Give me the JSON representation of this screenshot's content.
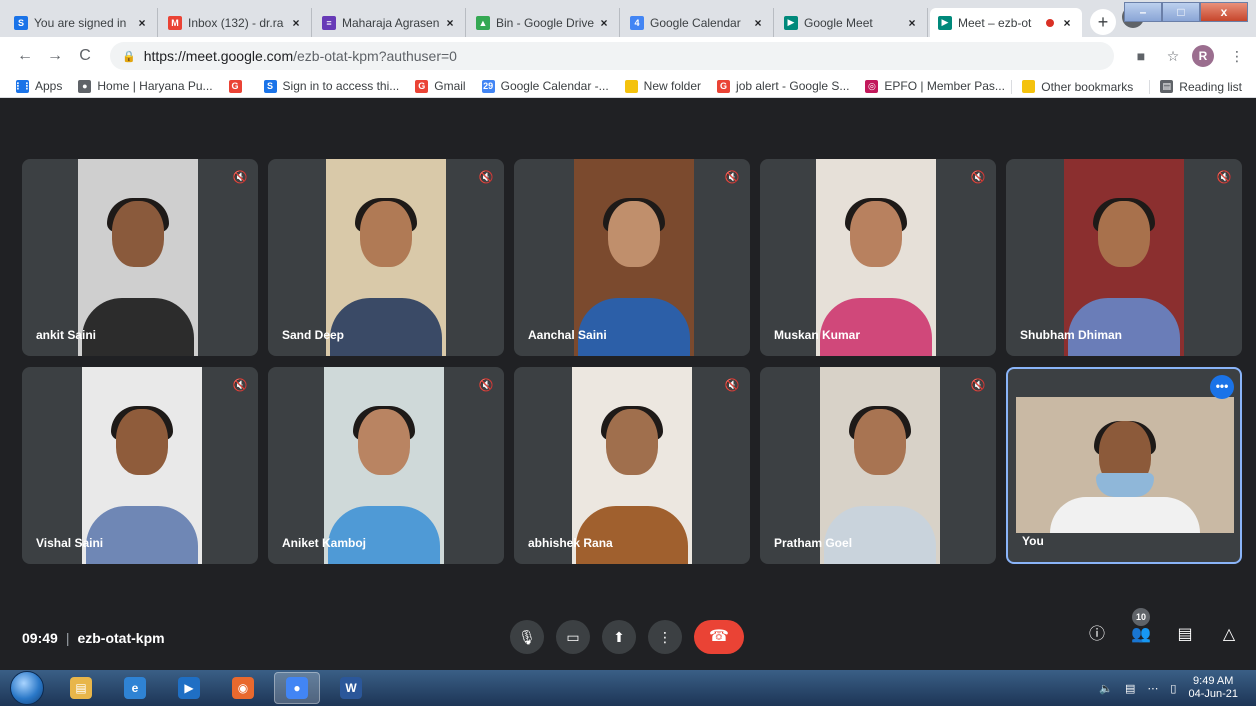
{
  "browser": {
    "tabs": [
      {
        "title": "You are signed in",
        "favicon": "S",
        "color": "#1a73e8"
      },
      {
        "title": "Inbox (132) - dr.ra",
        "favicon": "M",
        "color": "#ea4335"
      },
      {
        "title": "Maharaja Agrasen",
        "favicon": "≡",
        "color": "#673ab7"
      },
      {
        "title": "Bin - Google Drive",
        "favicon": "▲",
        "color": "#34a853"
      },
      {
        "title": "Google Calendar",
        "favicon": "4",
        "color": "#4285f4"
      },
      {
        "title": "Google Meet",
        "favicon": "▶",
        "color": "#00897b"
      },
      {
        "title": "Meet – ezb-ot",
        "favicon": "▶",
        "color": "#00897b"
      }
    ],
    "tab_close": "×",
    "new_tab": "+",
    "window_controls": {
      "minimize": "–",
      "maximize": "□",
      "close": "x"
    },
    "nav": {
      "back": "←",
      "forward": "→",
      "reload": "C"
    },
    "url_host": "https://meet.google.com",
    "url_path": "/ezb-otat-kpm?authuser=0",
    "toolbar_icons": {
      "camera": "■",
      "star": "☆",
      "menu": "⋮"
    },
    "profile_initial": "R",
    "bookmarks": [
      {
        "label": "Apps",
        "icon": "⋮⋮",
        "color": "#1a73e8"
      },
      {
        "label": "Home | Haryana Pu...",
        "icon": "●",
        "color": "#5f6368"
      },
      {
        "label": "",
        "icon": "G",
        "color": "#ea4335"
      },
      {
        "label": "Sign in to access thi...",
        "icon": "S",
        "color": "#1a73e8"
      },
      {
        "label": "Gmail",
        "icon": "G",
        "color": "#ea4335"
      },
      {
        "label": "Google Calendar -...",
        "icon": "29",
        "color": "#4285f4"
      },
      {
        "label": "New folder",
        "icon": "",
        "color": "#f4c20d"
      },
      {
        "label": "job alert - Google S...",
        "icon": "G",
        "color": "#ea4335"
      },
      {
        "label": "EPFO | Member Pas...",
        "icon": "◎",
        "color": "#c2185b"
      }
    ],
    "other_bookmarks": "Other bookmarks",
    "reading_list": "Reading list"
  },
  "participants": [
    {
      "name": "ankit Saini",
      "bg": "#cfcfcf",
      "skin": "#8a5a3c",
      "shirt": "#2c2c2c"
    },
    {
      "name": "Sand Deep",
      "bg": "#d9c9a9",
      "skin": "#b07a55",
      "shirt": "#3a4a66"
    },
    {
      "name": "Aanchal Saini",
      "bg": "#7b4a2e",
      "skin": "#c08f6c",
      "shirt": "#2c5fa8"
    },
    {
      "name": "Muskan Kumar",
      "bg": "#e6e0d8",
      "skin": "#b8815f",
      "shirt": "#d0487a"
    },
    {
      "name": "Shubham Dhiman",
      "bg": "#8b2f2f",
      "skin": "#a8714c",
      "shirt": "#6a7db8"
    },
    {
      "name": "Vishal Saini",
      "bg": "#e9e9e9",
      "skin": "#8f5c3b",
      "shirt": "#6f87b5"
    },
    {
      "name": "Aniket Kamboj",
      "bg": "#cfd9d9",
      "skin": "#b98462",
      "shirt": "#4f9ad6"
    },
    {
      "name": "abhishek Rana",
      "bg": "#ece7e0",
      "skin": "#a06f4d",
      "shirt": "#a0602e"
    },
    {
      "name": "Pratham Goel",
      "bg": "#d8d2c8",
      "skin": "#a87452",
      "shirt": "#c9d3dc"
    }
  ],
  "self_tile": {
    "name": "You",
    "more": "•••",
    "skin": "#8c5a3a",
    "shirt": "#f1f1f1",
    "mask": "#8fb7d9"
  },
  "mute_icon": "🔇",
  "meeting": {
    "time": "09:49",
    "separator": "|",
    "code": "ezb-otat-kpm",
    "controls": {
      "mic": "🎙",
      "camera": "▭",
      "present": "⬆",
      "more": "⋮",
      "hangup": "☎"
    },
    "right_controls": {
      "info": "ⓘ",
      "people": "👥",
      "chat": "▤",
      "activities": "△"
    },
    "participant_count": "10"
  },
  "taskbar": {
    "apps": [
      {
        "name": "file-explorer",
        "glyph": "▤",
        "color": "#e8b64a"
      },
      {
        "name": "internet-explorer",
        "glyph": "e",
        "color": "#2f83d4"
      },
      {
        "name": "media-player",
        "glyph": "▶",
        "color": "#1f6fc4"
      },
      {
        "name": "firefox",
        "glyph": "◉",
        "color": "#e8692e"
      },
      {
        "name": "chrome",
        "glyph": "●",
        "color": "#4285f4"
      },
      {
        "name": "word",
        "glyph": "W",
        "color": "#2b579a"
      }
    ],
    "tray": {
      "volume": "🔈",
      "network": "▤",
      "signal": "⋯",
      "battery": "▯"
    },
    "clock_time": "9:49 AM",
    "clock_date": "04-Jun-21"
  }
}
